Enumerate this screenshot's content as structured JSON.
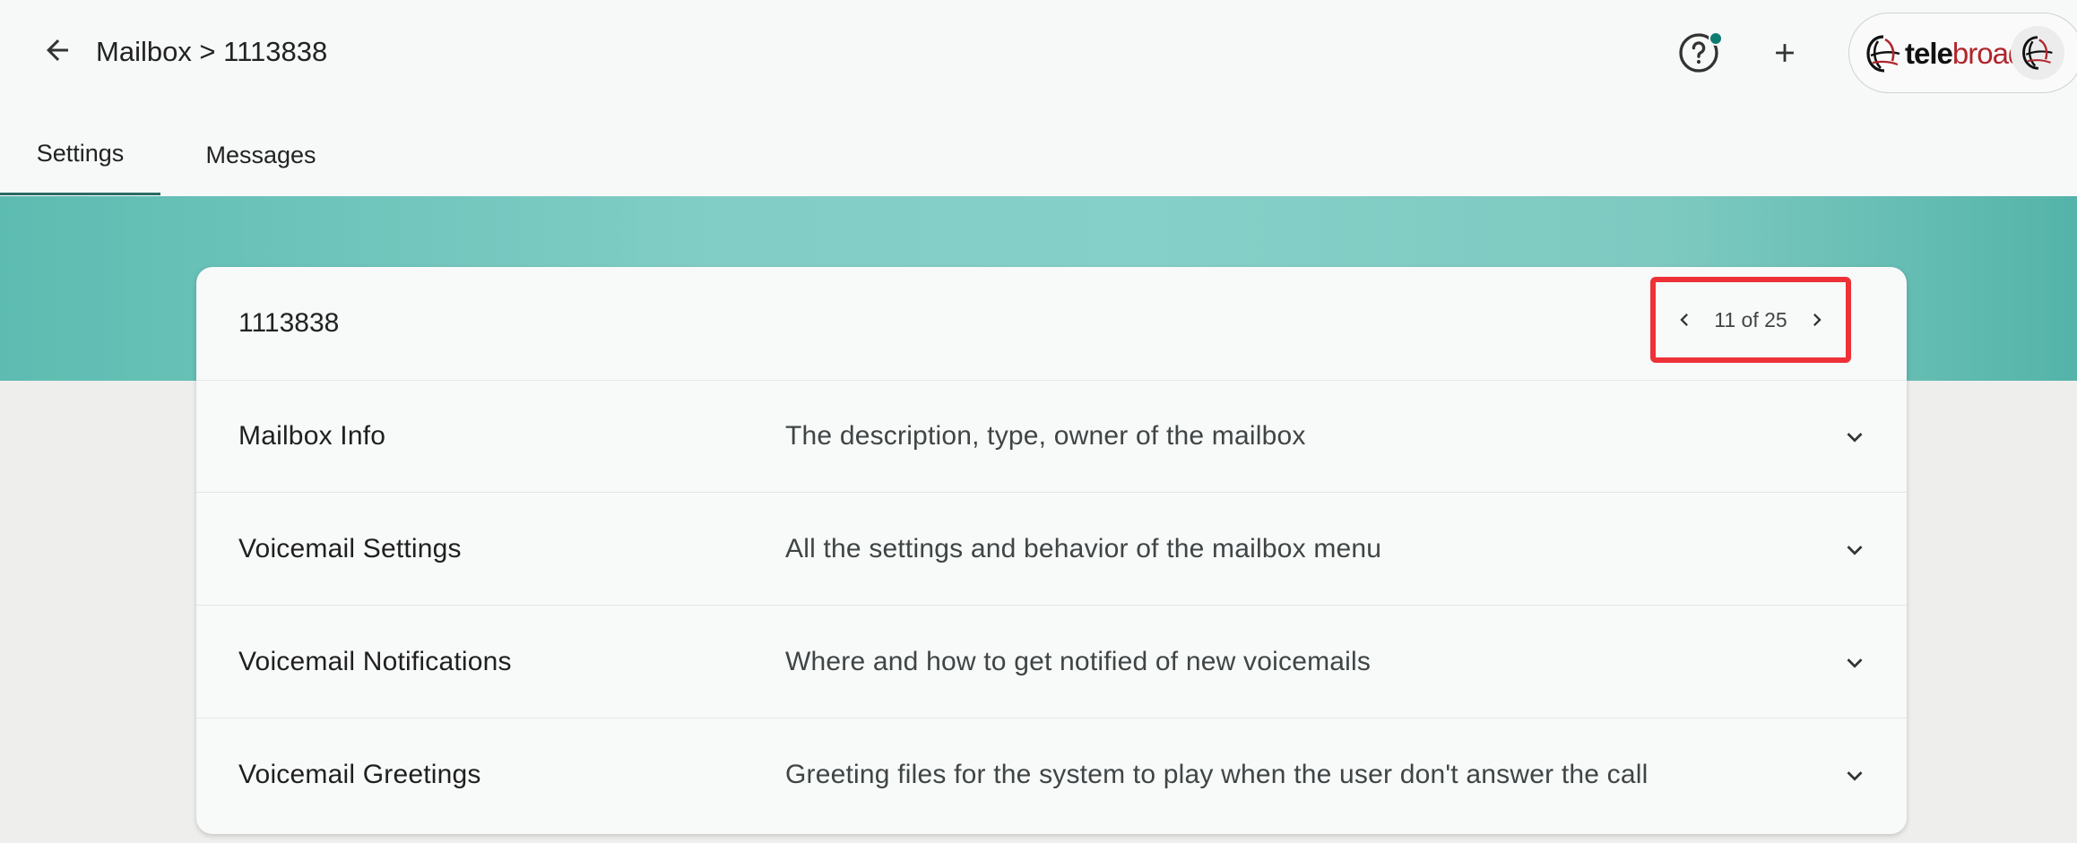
{
  "header": {
    "breadcrumb": "Mailbox > 1113838",
    "icons": {
      "back": "arrow-left-icon",
      "help": "help-circle-icon",
      "add": "plus-icon"
    },
    "brand": {
      "tele": "tele",
      "broad": "broad"
    }
  },
  "tabs": [
    {
      "label": "Settings",
      "active": true
    },
    {
      "label": "Messages",
      "active": false
    }
  ],
  "card": {
    "title": "1113838",
    "pager": {
      "text": "11 of 25",
      "current": 11,
      "total": 25
    },
    "sections": [
      {
        "title": "Mailbox Info",
        "description": "The description, type, owner of the mailbox"
      },
      {
        "title": "Voicemail Settings",
        "description": "All the settings and behavior of the mailbox menu"
      },
      {
        "title": "Voicemail Notifications",
        "description": "Where and how to get notified of new voicemails"
      },
      {
        "title": "Voicemail Greetings",
        "description": "Greeting files for the system to play when the user don't answer the call"
      }
    ]
  },
  "colors": {
    "accent": "#2a6b66",
    "notification_dot": "#0d7d72",
    "highlight_box": "#ee3137",
    "brand_red": "#b0262c"
  }
}
